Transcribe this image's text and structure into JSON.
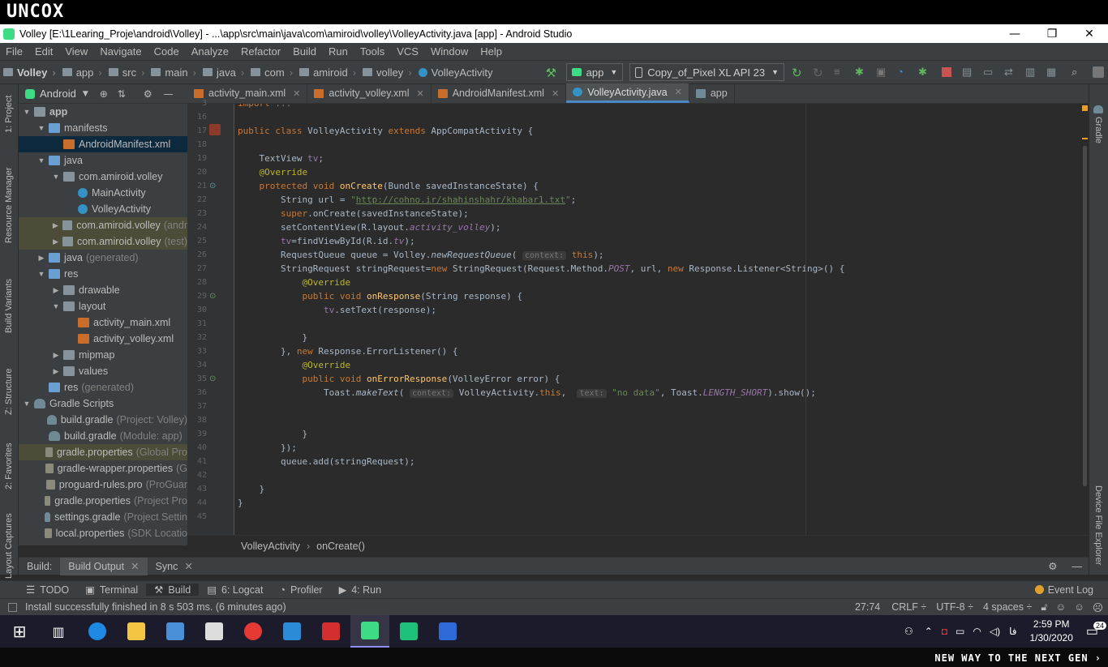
{
  "brand": {
    "logo": "UNCOX",
    "footer": "NEW WAY TO THE NEXT GEN ›"
  },
  "window": {
    "title": "Volley [E:\\1Learing_Proje\\android\\Volley] - ...\\app\\src\\main\\java\\com\\amiroid\\volley\\VolleyActivity.java [app] - Android Studio",
    "minimize": "—",
    "maximize": "❐",
    "close": "✕"
  },
  "menu": [
    "File",
    "Edit",
    "View",
    "Navigate",
    "Code",
    "Analyze",
    "Refactor",
    "Build",
    "Run",
    "Tools",
    "VCS",
    "Window",
    "Help"
  ],
  "nav": {
    "crumbs": [
      "Volley",
      "app",
      "src",
      "main",
      "java",
      "com",
      "amiroid",
      "volley",
      "VolleyActivity"
    ],
    "config": "app",
    "device": "Copy_of_Pixel XL API 23"
  },
  "project": {
    "view": "Android",
    "strip_left": [
      "1: Project",
      "Resource Manager",
      "Build Variants",
      "Z: Structure",
      "2: Favorites",
      "Layout Captures"
    ],
    "tree": [
      {
        "indent": 0,
        "arrow": "▼",
        "icon": "fold",
        "label": "app",
        "bold": true
      },
      {
        "indent": 1,
        "arrow": "▼",
        "icon": "foldblue",
        "label": "manifests"
      },
      {
        "indent": 2,
        "arrow": "",
        "icon": "xml",
        "label": "AndroidManifest.xml",
        "state": "sel"
      },
      {
        "indent": 1,
        "arrow": "▼",
        "icon": "foldblue",
        "label": "java"
      },
      {
        "indent": 2,
        "arrow": "▼",
        "icon": "fold",
        "label": "com.amiroid.volley"
      },
      {
        "indent": 3,
        "arrow": "",
        "icon": "cls",
        "label": "MainActivity"
      },
      {
        "indent": 3,
        "arrow": "",
        "icon": "cls",
        "label": "VolleyActivity"
      },
      {
        "indent": 2,
        "arrow": "▶",
        "icon": "fold",
        "label": "com.amiroid.volley",
        "dim": "(andr",
        "state": "hl"
      },
      {
        "indent": 2,
        "arrow": "▶",
        "icon": "fold",
        "label": "com.amiroid.volley",
        "dim": "(test)",
        "state": "hl"
      },
      {
        "indent": 1,
        "arrow": "▶",
        "icon": "foldblue",
        "label": "java",
        "dim": "(generated)"
      },
      {
        "indent": 1,
        "arrow": "▼",
        "icon": "foldblue",
        "label": "res"
      },
      {
        "indent": 2,
        "arrow": "▶",
        "icon": "fold",
        "label": "drawable"
      },
      {
        "indent": 2,
        "arrow": "▼",
        "icon": "fold",
        "label": "layout"
      },
      {
        "indent": 3,
        "arrow": "",
        "icon": "xml",
        "label": "activity_main.xml"
      },
      {
        "indent": 3,
        "arrow": "",
        "icon": "xml",
        "label": "activity_volley.xml"
      },
      {
        "indent": 2,
        "arrow": "▶",
        "icon": "fold",
        "label": "mipmap"
      },
      {
        "indent": 2,
        "arrow": "▶",
        "icon": "fold",
        "label": "values"
      },
      {
        "indent": 1,
        "arrow": "",
        "icon": "foldblue",
        "label": "res",
        "dim": "(generated)"
      },
      {
        "indent": 0,
        "arrow": "▼",
        "icon": "gradle",
        "label": "Gradle Scripts"
      },
      {
        "indent": 1,
        "arrow": "",
        "icon": "gradle",
        "label": "build.gradle",
        "dim": "(Project: Volley)"
      },
      {
        "indent": 1,
        "arrow": "",
        "icon": "gradle",
        "label": "build.gradle",
        "dim": "(Module: app)"
      },
      {
        "indent": 1,
        "arrow": "",
        "icon": "prop",
        "label": "gradle.properties",
        "dim": "(Global Pro",
        "state": "hl"
      },
      {
        "indent": 1,
        "arrow": "",
        "icon": "prop",
        "label": "gradle-wrapper.properties",
        "dim": "(G"
      },
      {
        "indent": 1,
        "arrow": "",
        "icon": "prop",
        "label": "proguard-rules.pro",
        "dim": "(ProGuar"
      },
      {
        "indent": 1,
        "arrow": "",
        "icon": "prop",
        "label": "gradle.properties",
        "dim": "(Project Pro"
      },
      {
        "indent": 1,
        "arrow": "",
        "icon": "gradle",
        "label": "settings.gradle",
        "dim": "(Project Settin"
      },
      {
        "indent": 1,
        "arrow": "",
        "icon": "prop",
        "label": "local.properties",
        "dim": "(SDK Locatio"
      }
    ]
  },
  "tabs": [
    {
      "label": "activity_main.xml",
      "icon": "xml"
    },
    {
      "label": "activity_volley.xml",
      "icon": "xml"
    },
    {
      "label": "AndroidManifest.xml",
      "icon": "xml"
    },
    {
      "label": "VolleyActivity.java",
      "icon": "cls",
      "active": true
    },
    {
      "label": "app",
      "icon": "gradle"
    }
  ],
  "editor": {
    "lines": [
      {
        "n": "3",
        "html": "<span class='kw'>import</span> <span class='dim2'>...</span>"
      },
      {
        "n": "16",
        "html": ""
      },
      {
        "n": "17",
        "html": "<span class='kw'>public class</span> VolleyActivity <span class='kw'>extends</span> AppCompatActivity {"
      },
      {
        "n": "18",
        "html": ""
      },
      {
        "n": "19",
        "html": "    TextView <span class='fld'>tv</span>;"
      },
      {
        "n": "20",
        "html": "    <span class='ann'>@Override</span>"
      },
      {
        "n": "21",
        "html": "    <span class='kw'>protected void</span> <span class='fn'>onCreate</span>(Bundle savedInstanceState) {"
      },
      {
        "n": "22",
        "html": "        String url = <span class='str'>\"<span class='link'>http://cohno.ir/shahinshahr/khabar1.txt</span>\"</span>;"
      },
      {
        "n": "23",
        "html": "        <span class='kw'>super</span>.onCreate(savedInstanceState);"
      },
      {
        "n": "24",
        "html": "        setContentView(R.layout.<span class='fld ital'>activity_volley</span>);"
      },
      {
        "n": "25",
        "html": "        <span class='fld'>tv</span>=findViewById(R.id.<span class='fld ital'>tv</span>);"
      },
      {
        "n": "26",
        "html": "        RequestQueue queue = Volley.<span class='ital'>newRequestQueue</span>( <span class='hint'>context:</span> <span class='kw'>this</span>);"
      },
      {
        "n": "27",
        "html": "        StringRequest stringRequest=<span class='kw'>new</span> StringRequest(Request.Method.<span class='fld ital'>POST</span>, url, <span class='kw'>new</span> Response.Listener&lt;String&gt;() {"
      },
      {
        "n": "28",
        "html": "            <span class='ann'>@Override</span>"
      },
      {
        "n": "29",
        "html": "            <span class='kw'>public void</span> <span class='fn'>onResponse</span>(String response) {"
      },
      {
        "n": "30",
        "html": "                <span class='fld'>tv</span>.setText(response);"
      },
      {
        "n": "31",
        "html": ""
      },
      {
        "n": "32",
        "html": "            }"
      },
      {
        "n": "33",
        "html": "        }, <span class='kw'>new</span> Response.ErrorListener() {"
      },
      {
        "n": "34",
        "html": "            <span class='ann'>@Override</span>"
      },
      {
        "n": "35",
        "html": "            <span class='kw'>public void</span> <span class='fn'>onErrorResponse</span>(VolleyError error) {"
      },
      {
        "n": "36",
        "html": "                Toast.<span class='ital'>makeText</span>( <span class='hint'>context:</span> VolleyActivity.<span class='kw'>this</span>,  <span class='hint'>text:</span> <span class='str'>\"no data\"</span>, Toast.<span class='fld ital'>LENGTH_SHORT</span>).show();"
      },
      {
        "n": "37",
        "html": ""
      },
      {
        "n": "38",
        "html": ""
      },
      {
        "n": "39",
        "html": "            }"
      },
      {
        "n": "40",
        "html": "        });"
      },
      {
        "n": "41",
        "html": "        queue.add(stringRequest);"
      },
      {
        "n": "42",
        "html": ""
      },
      {
        "n": "43",
        "html": "    }"
      },
      {
        "n": "44",
        "html": "}"
      },
      {
        "n": "45",
        "html": ""
      }
    ],
    "breadcrumb_class": "VolleyActivity",
    "breadcrumb_sep": "›",
    "breadcrumb_method": "onCreate()"
  },
  "right_strip": [
    "Gradle",
    "Device File Explorer"
  ],
  "build_bar": {
    "label": "Build:",
    "tabs": [
      {
        "label": "Build Output",
        "active": true
      },
      {
        "label": "Sync"
      }
    ]
  },
  "bottom_tools": {
    "items": [
      {
        "label": "TODO"
      },
      {
        "label": "Terminal"
      },
      {
        "label": "Build",
        "active": true
      },
      {
        "label": "6: Logcat"
      },
      {
        "label": "Profiler"
      },
      {
        "label": "4: Run"
      }
    ],
    "event_log": "Event Log"
  },
  "status": {
    "message": "Install successfully finished in 8 s 503 ms. (6 minutes ago)",
    "position": "27:74",
    "line_sep": "CRLF ÷",
    "encoding": "UTF-8 ÷",
    "indent": "4 spaces ÷"
  },
  "taskbar": {
    "time": "2:59 PM",
    "date": "1/30/2020",
    "lang": "فا",
    "notif_count": "24",
    "colors": {
      "edge": "#1e88e5",
      "explorer": "#f4c542",
      "store": "#4a90d9",
      "mail": "#dddddd",
      "chrome": "#e53935",
      "ps": "#2b8bd6",
      "pdf": "#d32f2f",
      "studio": "#3ddc84",
      "sheet": "#1dbf7a",
      "word": "#2d6ad8"
    }
  }
}
